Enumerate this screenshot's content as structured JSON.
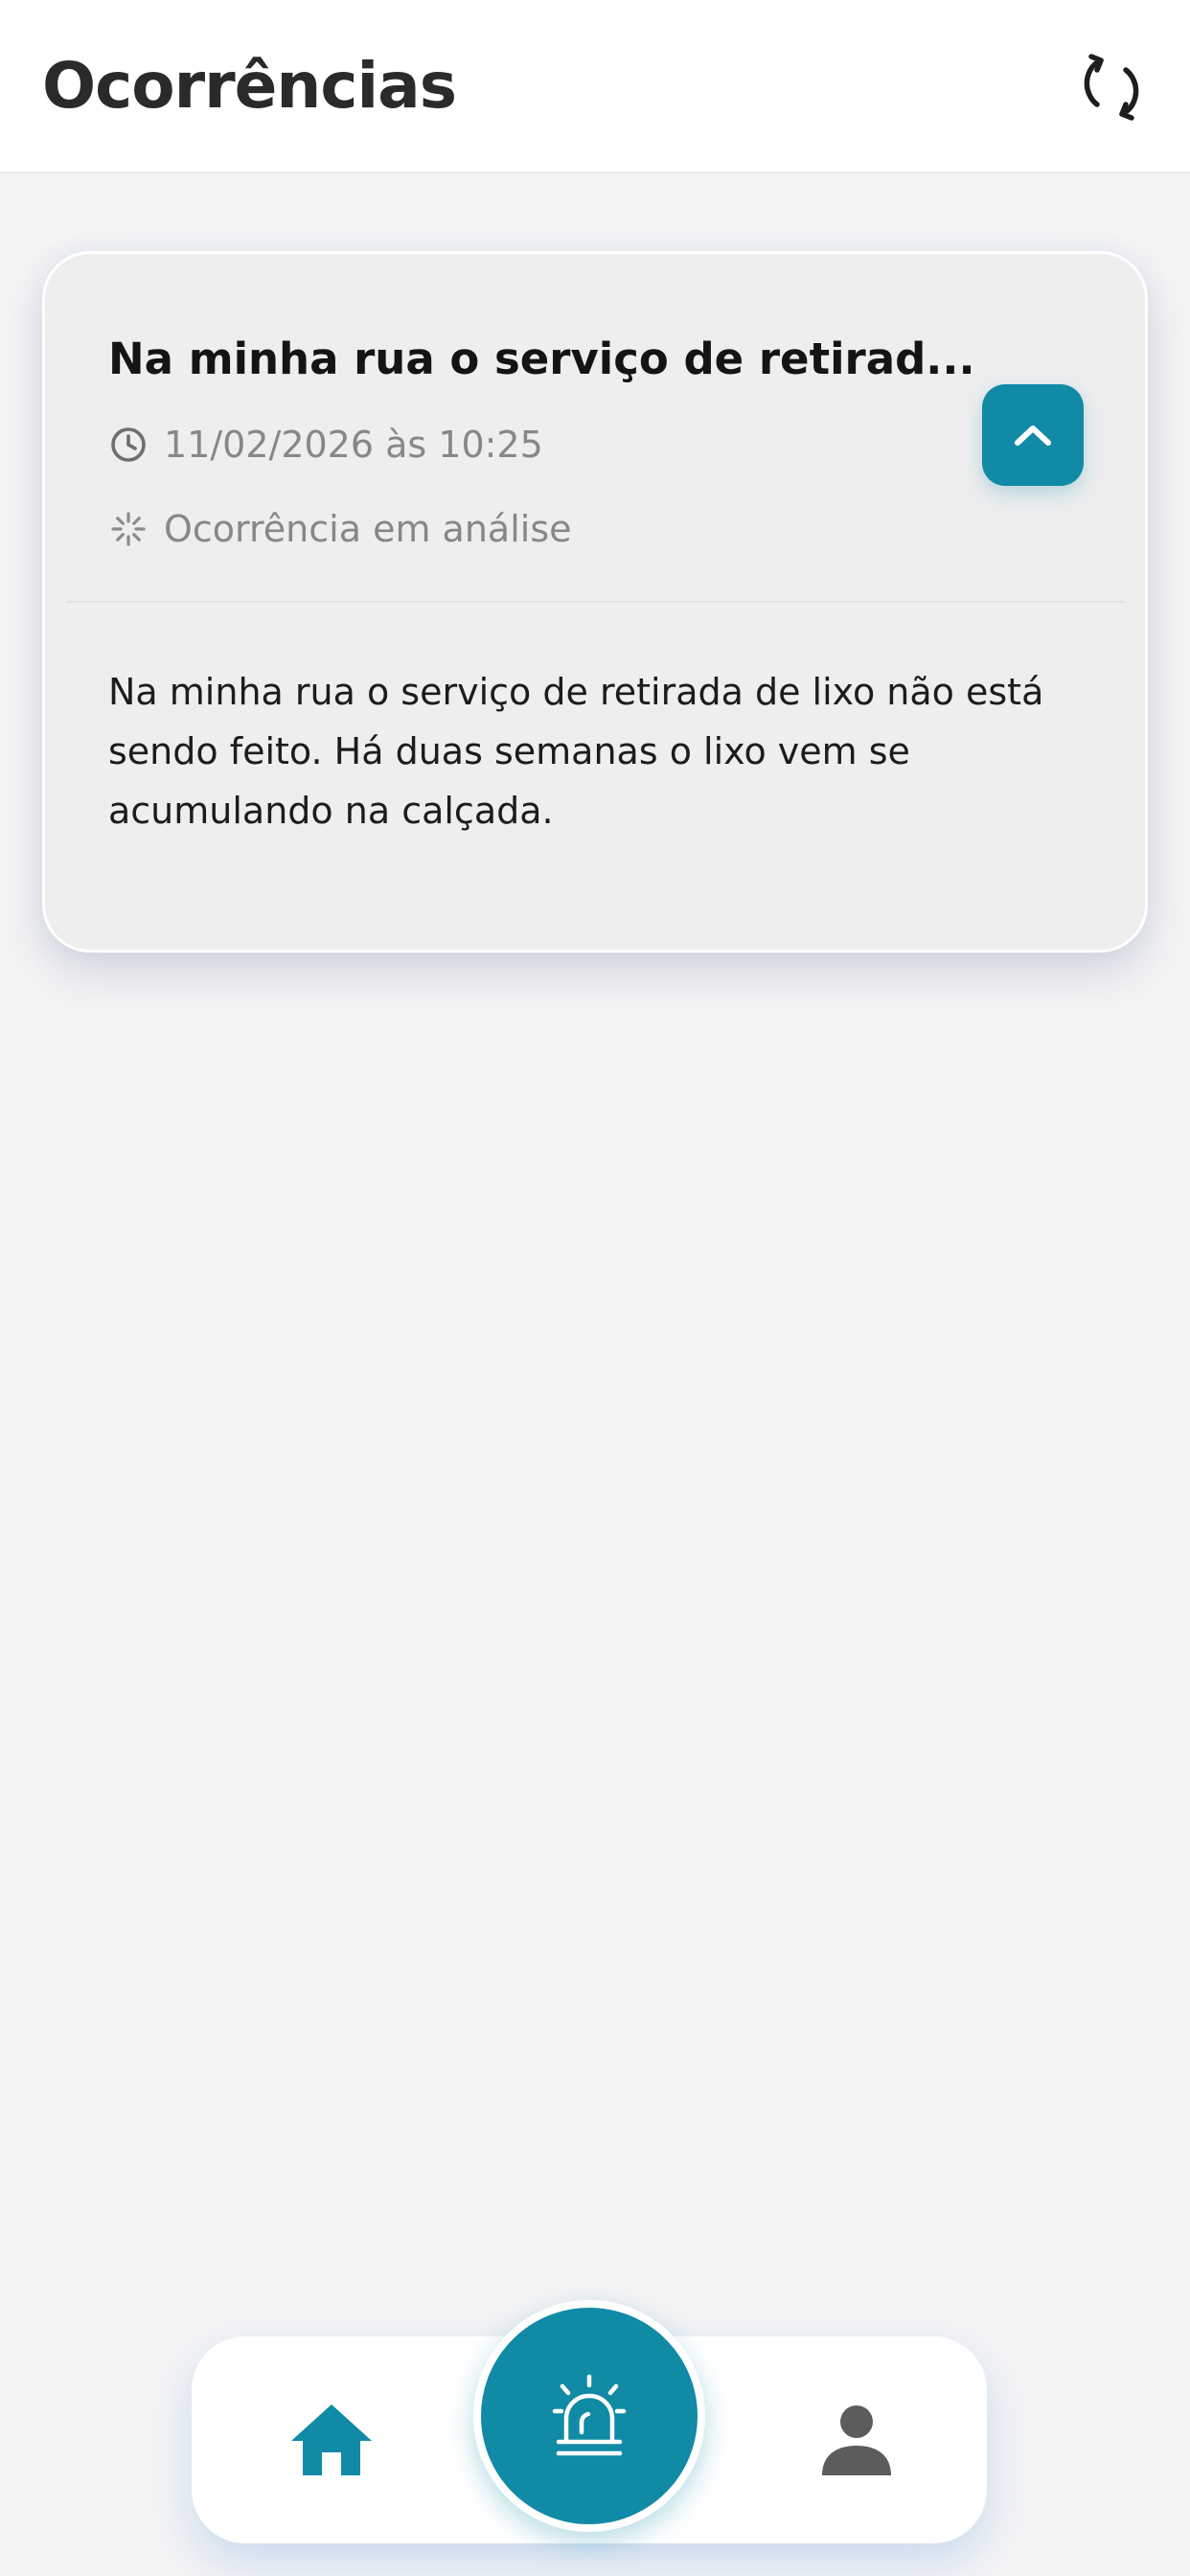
{
  "header": {
    "title": "Ocorrências",
    "refresh_icon": "refresh-icon"
  },
  "occurrence": {
    "title": "Na minha rua o serviço de retirad...",
    "date": "11/02/2026 às 10:25",
    "status": "Ocorrência em análise",
    "description": "Na minha rua o serviço de retirada de lixo não está sendo feito. Há duas semanas o lixo vem se acumulando na calçada.",
    "expanded": true,
    "icons": {
      "date": "clock-icon",
      "status": "spinner-icon",
      "toggle": "chevron-up-icon"
    }
  },
  "bottom_nav": {
    "items": [
      {
        "id": "home",
        "icon": "home-icon"
      },
      {
        "id": "occurrences",
        "icon": "siren-icon",
        "active": true
      },
      {
        "id": "profile",
        "icon": "person-icon"
      }
    ]
  },
  "colors": {
    "accent": "#118aa6",
    "background": "#f4f4f5",
    "card": "#eeeeef",
    "title_text": "#2a2a2a",
    "muted_text": "#878787",
    "profile_icon": "#5c5c5c"
  }
}
